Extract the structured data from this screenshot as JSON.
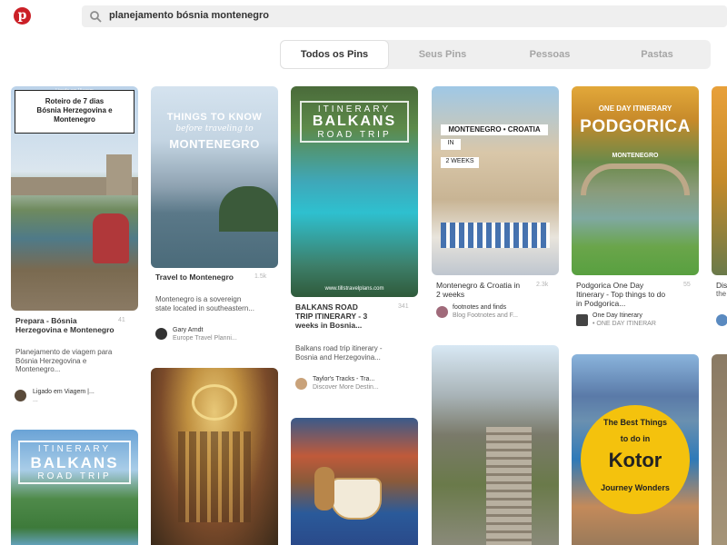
{
  "search": {
    "query": "planejamento bósnia montenegro"
  },
  "tabs": [
    {
      "label": "Todos os Pins",
      "active": true
    },
    {
      "label": "Seus Pins",
      "active": false
    },
    {
      "label": "Pessoas",
      "active": false
    },
    {
      "label": "Pastas",
      "active": false
    }
  ],
  "pins": {
    "bosnia": {
      "tag": "Ligado em Viagem",
      "overlay": "Roteiro de 7 dias\nBósnia Herzegovina e\nMontenegro",
      "title": "Prepara - Bósnia Herzegovina e Montenegro",
      "count": "41",
      "desc": "Planejamento de viagem para Bósnia Herzegovina e Montenegro...",
      "author": "Ligado em Viagem |...",
      "author_sub": "..."
    },
    "montenegro": {
      "overlay_1": "THINGS TO KNOW",
      "overlay_2": "before traveling to",
      "overlay_3": "MONTENEGRO",
      "title": "Travel to Montenegro",
      "count": "1.5k",
      "desc": "Montenegro is a sovereign state located in southeastern...",
      "author": "Gary Arndt",
      "author_sub": "Europe Travel Planni..."
    },
    "balkans": {
      "overlay_1": "ITINERARY",
      "overlay_2": "BALKANS",
      "overlay_3": "ROAD TRIP",
      "watermark": "www.tillstravelplans.com",
      "title": "BALKANS ROAD TRIP ITINERARY - 3 weeks in Bosnia...",
      "count": "341",
      "desc": "Balkans road trip itinerary - Bosnia and Herzegovina...",
      "author": "Taylor's Tracks - Tra...",
      "author_sub": "Discover More Destin..."
    },
    "croatia": {
      "overlay_1": "MONTENEGRO • CROATIA",
      "overlay_2": "IN",
      "overlay_3": "2 WEEKS",
      "title": "Montenegro & Croatia in 2 weeks",
      "count": "2.3k",
      "author": "footnotes and finds",
      "author_sub": "Blog Footnotes and F..."
    },
    "podgorica": {
      "overlay_1": "ONE DAY ITINERARY",
      "overlay_2": "PODGORICA",
      "overlay_3": "MONTENEGRO",
      "title": "Podgorica One Day Itinerary - Top things to do in Podgorica...",
      "count": "55",
      "author": "One Day Itinerary",
      "author_sub": "• ONE DAY ITINERAR"
    },
    "edge": {
      "title": "Disc",
      "desc": "the"
    },
    "balkans2": {
      "overlay_1": "ITINERARY",
      "overlay_2": "BALKANS",
      "overlay_3": "ROAD TRIP"
    },
    "kotor": {
      "overlay_1": "The Best Things",
      "overlay_2": "to do in",
      "overlay_3": "Kotor",
      "overlay_4": "Journey Wonders"
    }
  },
  "colors": {
    "brand": "#cb2027",
    "search_bg": "#efefef",
    "kotor_circle": "#f4c20d"
  }
}
